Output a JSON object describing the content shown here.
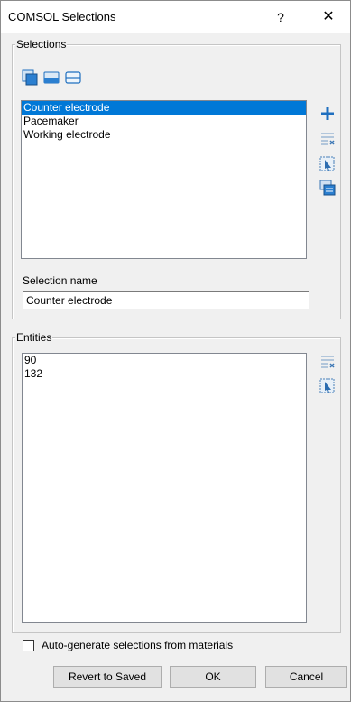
{
  "window": {
    "title": "COMSOL Selections",
    "help_label": "?",
    "close_label": "✕"
  },
  "selections": {
    "group_label": "Selections",
    "toolbar_icons": [
      "domain-selection-icon",
      "boundary-selection-icon",
      "edge-selection-icon"
    ],
    "items": [
      "Counter electrode",
      "Pacemaker",
      "Working electrode"
    ],
    "selected_index": 0,
    "side_icons": [
      "add-icon",
      "remove-entities-icon",
      "select-in-graphics-icon",
      "duplicate-icon"
    ],
    "name_label": "Selection name",
    "name_value": "Counter electrode"
  },
  "entities": {
    "group_label": "Entities",
    "items": [
      "90",
      "132"
    ],
    "side_icons": [
      "remove-entities-icon",
      "select-in-graphics-icon"
    ]
  },
  "footer": {
    "autogen_label": "Auto-generate selections from materials",
    "autogen_checked": false,
    "revert_label": "Revert to Saved",
    "ok_label": "OK",
    "cancel_label": "Cancel"
  },
  "colors": {
    "selection_highlight": "#0078d7",
    "icon_blue": "#1f6fbf"
  }
}
